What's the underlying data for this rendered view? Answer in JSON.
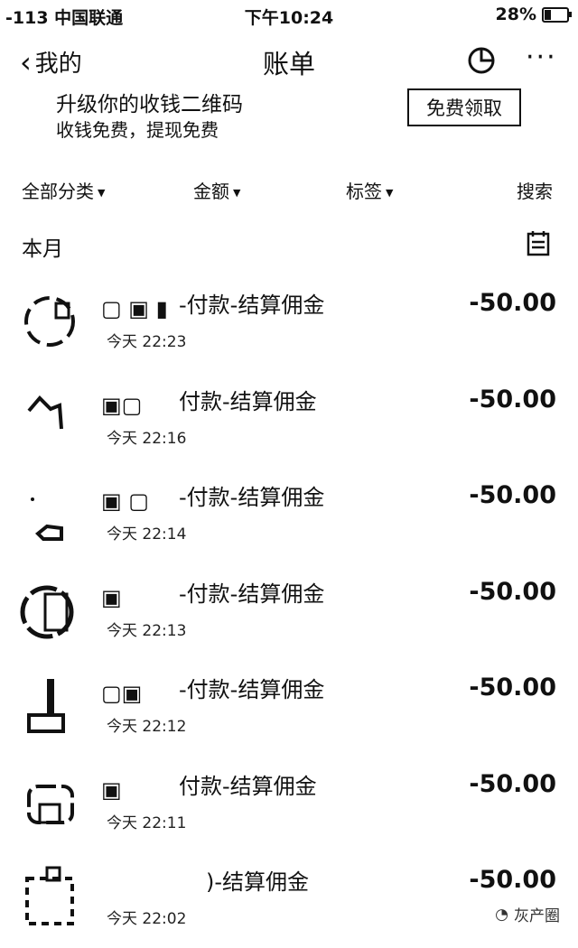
{
  "status_bar": {
    "signal": "-113 中国联通",
    "time": "下午10:24",
    "battery": "28%",
    "battery_level": 0.28
  },
  "nav": {
    "back_label": "我的",
    "title": "账单"
  },
  "banner": {
    "line1": "升级你的收钱二维码",
    "line2": "收钱免费，提现免费",
    "button": "免费领取"
  },
  "filters": [
    {
      "label": "全部分类",
      "has_caret": true
    },
    {
      "label": "金额",
      "has_caret": true
    },
    {
      "label": "标签",
      "has_caret": true
    },
    {
      "label": "搜索",
      "has_caret": false
    }
  ],
  "section": {
    "label": "本月"
  },
  "transactions": [
    {
      "title": "-付款-结算佣金",
      "time": "今天  22:23",
      "amount": "-50.00"
    },
    {
      "title": "付款-结算佣金",
      "time": "今天  22:16",
      "amount": "-50.00"
    },
    {
      "title": "-付款-结算佣金",
      "time": "今天  22:14",
      "amount": "-50.00"
    },
    {
      "title": "-付款-结算佣金",
      "time": "今天  22:13",
      "amount": "-50.00"
    },
    {
      "title": "-付款-结算佣金",
      "time": "今天  22:12",
      "amount": "-50.00"
    },
    {
      "title": "付款-结算佣金",
      "time": "今天  22:11",
      "amount": "-50.00"
    },
    {
      "title": ")-结算佣金",
      "time": "今天  22:02",
      "amount": "-50.00"
    }
  ],
  "watermark": "灰产圈"
}
